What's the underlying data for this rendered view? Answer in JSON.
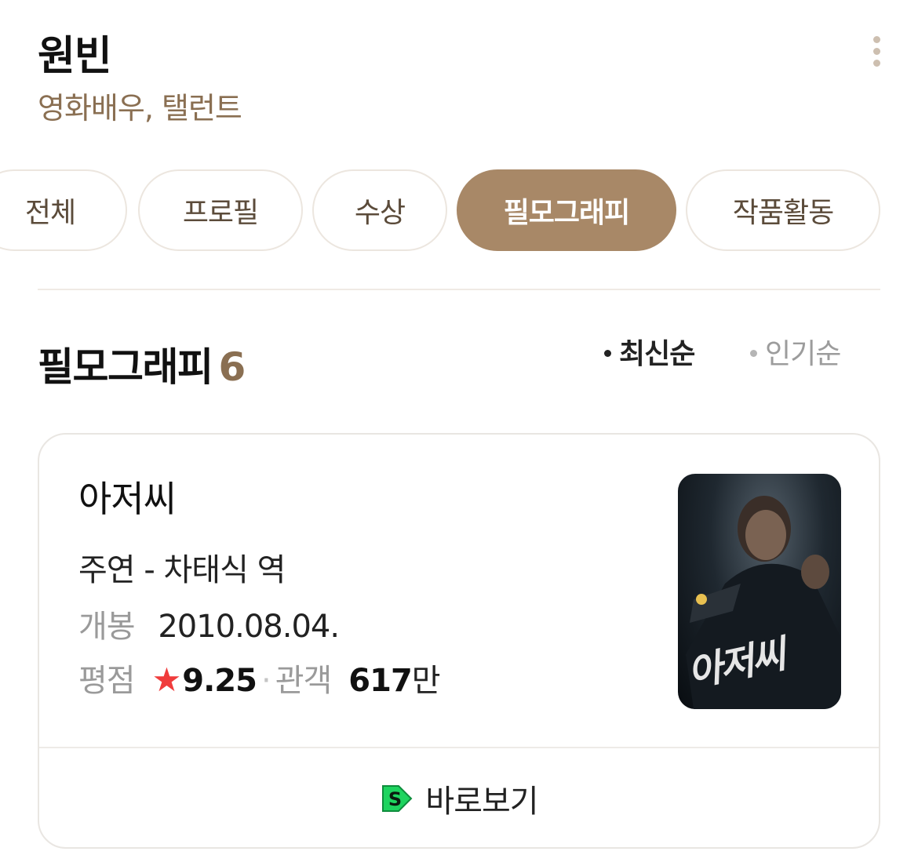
{
  "profile": {
    "name": "원빈",
    "occupation": "영화배우, 탤런트"
  },
  "tabs": [
    {
      "label": "전체",
      "active": false
    },
    {
      "label": "프로필",
      "active": false
    },
    {
      "label": "수상",
      "active": false
    },
    {
      "label": "필모그래피",
      "active": true
    },
    {
      "label": "작품활동",
      "active": false
    }
  ],
  "section": {
    "title": "필모그래피",
    "count": "6"
  },
  "sort": {
    "latest": "최신순",
    "popular": "인기순",
    "selected": "최신순"
  },
  "movie": {
    "title": "아저씨",
    "role": "주연 - 차태식 역",
    "release_label": "개봉",
    "release_date": "2010.08.04.",
    "rating_label": "평점",
    "rating": "9.25",
    "separator": "·",
    "audience_label": "관객",
    "audience_count": "617",
    "audience_unit": "만",
    "poster_text": "아저씨",
    "watch_label": "바로보기"
  },
  "colors": {
    "accent": "#a88867",
    "accent_text": "#8a6f52",
    "star": "#f03c3c",
    "watch_icon": "#1ed45f"
  },
  "icons": {
    "menu": "more-vertical-icon",
    "star": "star-icon",
    "watch": "play-service-icon"
  }
}
